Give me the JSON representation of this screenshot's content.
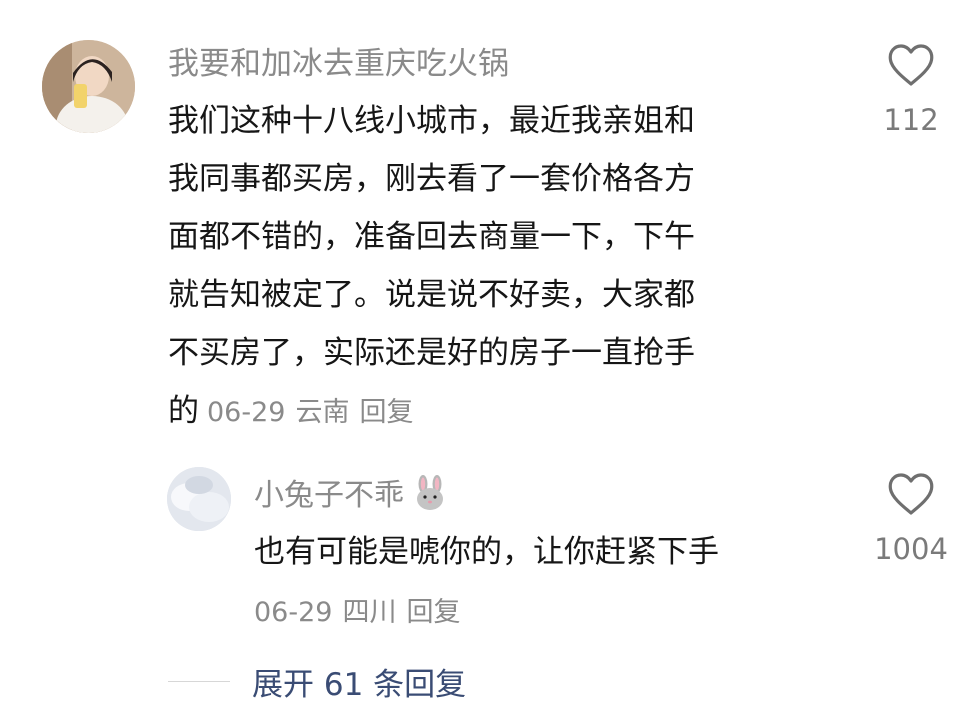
{
  "comment": {
    "username": "我要和加冰去重庆吃火锅",
    "text_lines": [
      "我们这种十八线小城市，最近我亲姐和",
      "我同事都买房，刚去看了一套价格各方",
      "面都不错的，准备回去商量一下，下午",
      "就告知被定了。说是说不好卖，大家都",
      "不买房了，实际还是好的房子一直抢手",
      "的"
    ],
    "date": "06-29",
    "location": "云南",
    "reply_label": "回复",
    "like_count": "112",
    "avatar_icon": "user-photo-avatar"
  },
  "reply": {
    "username": "小兔子不乖",
    "emoji_icon": "rabbit-face-icon",
    "text": "也有可能是唬你的，让你赶紧下手",
    "date": "06-29",
    "location": "四川",
    "reply_label": "回复",
    "like_count": "1004",
    "avatar_icon": "user-photo-avatar"
  },
  "expand": {
    "label": "展开 61 条回复"
  },
  "colors": {
    "text_primary": "#161616",
    "text_secondary": "#8a8a8a",
    "link": "#3a4c74",
    "divider": "#d7d7d7"
  }
}
